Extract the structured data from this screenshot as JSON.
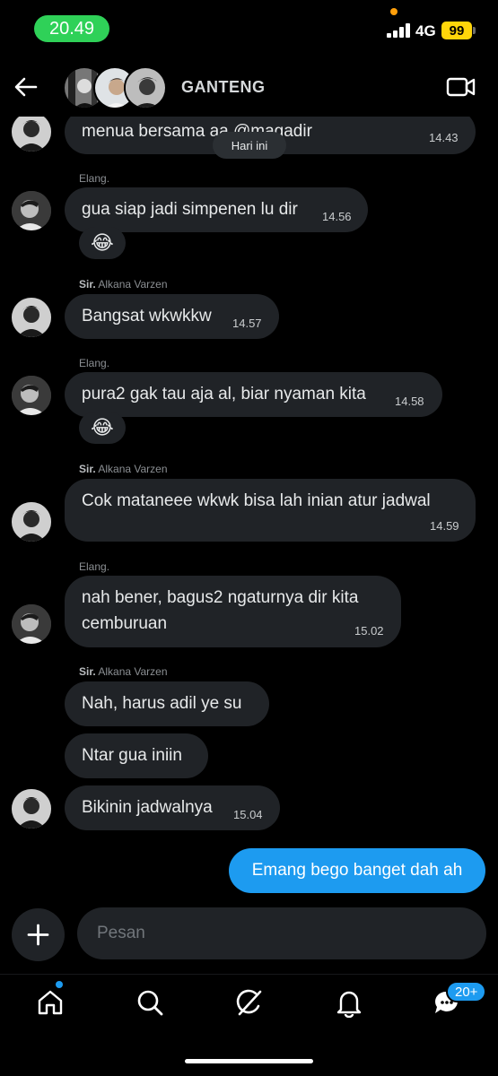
{
  "status": {
    "time": "20.49",
    "network": "4G",
    "battery": "99"
  },
  "header": {
    "title": "GANTENG"
  },
  "day_divider": "Hari ini",
  "messages": [
    {
      "sender_prefix": "",
      "sender": "",
      "text": "menua bersama aa @magadir",
      "time": "14.43"
    },
    {
      "sender_prefix": "",
      "sender": "Elang.",
      "text": "gua siap jadi simpenen lu dir",
      "time": "14.56",
      "reaction": "😂"
    },
    {
      "sender_prefix": "Sir.",
      "sender": "Alkana Varzen",
      "text": "Bangsat wkwkkw",
      "time": "14.57"
    },
    {
      "sender_prefix": "",
      "sender": "Elang.",
      "text": "pura2 gak tau aja al, biar nyaman kita",
      "time": "14.58",
      "reaction": "😂"
    },
    {
      "sender_prefix": "Sir.",
      "sender": "Alkana Varzen",
      "text": "Cok mataneee wkwk bisa lah inian atur jadwal",
      "time": "14.59"
    },
    {
      "sender_prefix": "",
      "sender": "Elang.",
      "text_line1": "nah bener, bagus2 ngaturnya dir kita",
      "text_line2": "cemburuan",
      "time": "15.02"
    },
    {
      "sender_prefix": "Sir.",
      "sender": "Alkana Varzen",
      "text": "Nah, harus adil ye su"
    },
    {
      "text": "Ntar gua iniin"
    },
    {
      "text": "Bikinin jadwalnya",
      "time": "15.04"
    }
  ],
  "my_message": {
    "text": "Emang bego banget dah ah"
  },
  "composer": {
    "placeholder": "Pesan"
  },
  "tabbar": {
    "notification_badge": "20+"
  },
  "colors": {
    "accent": "#1d9bf0",
    "bubble": "#202327",
    "background": "#000000",
    "time_pill": "#2fd158",
    "battery": "#ffd60a"
  },
  "icons": [
    "back-arrow-icon",
    "video-call-icon",
    "plus-icon",
    "home-icon",
    "search-icon",
    "grok-icon",
    "bell-icon",
    "messages-icon"
  ]
}
